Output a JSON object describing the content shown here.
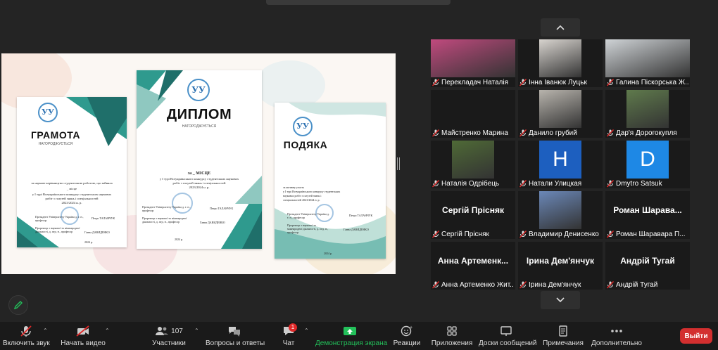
{
  "shared_content": {
    "doc1": {
      "title": "ГРАМОТА",
      "subtitle": "НАГОРОДЖУЄТЬСЯ",
      "line1": "за наукове керівництво студентською роботою, що зайняла",
      "line2": "_ місце",
      "line3": "у І турі Всеукраїнського конкурсу студентських наукових",
      "line4": "робіт з галузей знань і спеціальностей",
      "line5": "2023/2024 н. р.",
      "sign1": "Президент Університету Україна д. т. н., професор",
      "sign1_name": "Петро ТАЛАНЧУК",
      "sign2": "Проректор з наукової та міжнародної діяльності, д. пед. н., професор",
      "sign2_name": "Ганна ДАВИДЕНКО",
      "year": "2024 р."
    },
    "doc2": {
      "title": "ДИПЛОМ",
      "subtitle": "НАГОРОДЖУЄТЬСЯ",
      "line1": "за _ МІСЦЕ",
      "line2": "у І турі Всеукраїнського конкурсу студентських наукових",
      "line3": "робіт з галузей знань і спеціальностей",
      "line4": "2023/2024 н. р.",
      "sign1": "Президент Університету Україна д. т. н., професор",
      "sign1_name": "Петро ТАЛАНЧУК",
      "sign2": "Проректор з наукової та міжнародної діяльності, д. пед. н., професор",
      "sign2_name": "Ганна ДАВИДЕНКО",
      "year": "2024 р."
    },
    "doc3": {
      "title": "ПОДЯКА",
      "line1": "за активну участь",
      "line2": "у І турі Всеукраїнського конкурсу студентських",
      "line3": "наукових робіт з галузей знань і",
      "line4": "спеціальностей 2023/2024 н. р.",
      "sign1": "Президент Університету Україна д. т. н., професор",
      "sign1_name": "Петро ТАЛАНЧУК",
      "sign2": "Проректор з наукової та міжнародної діяльності, д. пед. н., професор",
      "sign2_name": "Ганна ДАВИДЕНКО",
      "year": "2024 р."
    },
    "emblem": "УУ"
  },
  "participants": [
    {
      "caption": "Перекладач Наталія",
      "type": "video",
      "bg": "#c04a7e"
    },
    {
      "caption": "Інна Іванюк Луцьк",
      "type": "video",
      "bg": "#d8d4cf"
    },
    {
      "caption": "Галина Піскорська Ж...",
      "type": "video",
      "bg": "#cfd3d6"
    },
    {
      "caption": "Майстренко Марина",
      "type": "blank"
    },
    {
      "caption": "Данило грубий",
      "type": "video",
      "bg": "#b8b4ad"
    },
    {
      "caption": "Дар'я Дорогокупля",
      "type": "video",
      "bg": "#5f7a4c"
    },
    {
      "caption": "Наталія Одрібець",
      "type": "video",
      "bg": "#4f6a36"
    },
    {
      "caption": "Натали Улицкая",
      "type": "letter",
      "letter": "H",
      "bg": "#1d5fbf"
    },
    {
      "caption": "Dmytro Satsuk",
      "type": "letter",
      "letter": "D",
      "bg": "#1e88e5"
    },
    {
      "caption": "Сергій Прісняк",
      "type": "name",
      "name": "Сергій Прісняк"
    },
    {
      "caption": "Владимир Денисенко",
      "type": "video",
      "bg": "#6b88b8"
    },
    {
      "caption": "Роман Шаравара П...",
      "type": "name",
      "name": "Роман Шарава..."
    },
    {
      "caption": "Анна Артеменко Жит...",
      "type": "name",
      "name": "Анна Артеменк..."
    },
    {
      "caption": "Ірина Дем'янчук",
      "type": "name",
      "name": "Ірина Дем'янчук"
    },
    {
      "caption": "Андрій Тугай",
      "type": "name",
      "name": "Андрій Тугай"
    }
  ],
  "toolbar": {
    "mute_label": "Включить звук",
    "video_label": "Начать видео",
    "participants_label": "Участники",
    "participants_count": "107",
    "qa_label": "Вопросы и ответы",
    "chat_label": "Чат",
    "chat_badge": "1",
    "share_label": "Демонстрация экрана",
    "reactions_label": "Реакции",
    "apps_label": "Приложения",
    "whiteboard_label": "Доски сообщений",
    "notes_label": "Примечания",
    "more_label": "Дополнительно",
    "leave_label": "Выйти"
  },
  "colors": {
    "share_green": "#23c05a",
    "leave_red": "#d32f2f",
    "teal": "#2f9a8e"
  }
}
